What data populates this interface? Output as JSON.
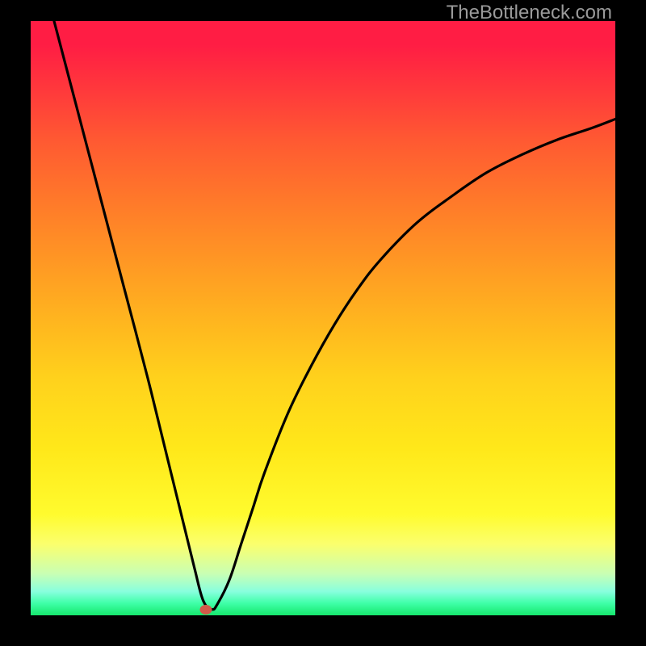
{
  "watermark": "TheBottleneck.com",
  "chart_data": {
    "type": "line",
    "title": "",
    "xlabel": "",
    "ylabel": "",
    "xlim": [
      0,
      100
    ],
    "ylim": [
      0,
      100
    ],
    "grid": false,
    "legend": false,
    "series": [
      {
        "name": "bottleneck-curve",
        "x": [
          4,
          8,
          12,
          16,
          20,
          24,
          26,
          28,
          29.5,
          31,
          32,
          34,
          36,
          38,
          40,
          44,
          48,
          52,
          56,
          60,
          66,
          72,
          78,
          84,
          90,
          96,
          100
        ],
        "values": [
          100,
          85,
          70,
          55,
          40,
          24,
          16,
          8,
          2.5,
          1,
          2,
          6,
          12,
          18,
          24,
          34,
          42,
          49,
          55,
          60,
          66,
          70.5,
          74.5,
          77.5,
          80,
          82,
          83.5
        ]
      }
    ],
    "annotations": [
      {
        "name": "min-point-marker",
        "x": 30,
        "y": 1,
        "color": "#d15a49"
      }
    ],
    "background_gradient": {
      "top": "#ff1d44",
      "bottom": "#16e76d"
    }
  }
}
